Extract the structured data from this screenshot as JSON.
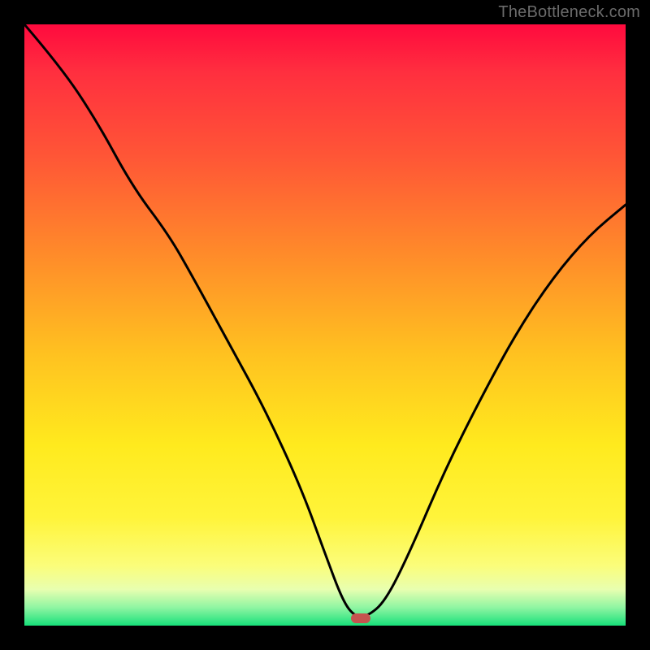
{
  "watermark": "TheBottleneck.com",
  "colors": {
    "background": "#000000",
    "curve": "#000000",
    "marker": "#c5534f",
    "watermark": "#6b6b6b",
    "gradient_top": "#ff0a3e",
    "gradient_bottom": "#17e07a"
  },
  "chart_data": {
    "type": "line",
    "title": "",
    "xlabel": "",
    "ylabel": "",
    "xlim": [
      0,
      100
    ],
    "ylim": [
      0,
      100
    ],
    "series": [
      {
        "name": "bottleneck-curve",
        "x": [
          0,
          6,
          12,
          18,
          24,
          28,
          34,
          40,
          46,
          50,
          53,
          55,
          57,
          60,
          64,
          70,
          76,
          82,
          88,
          94,
          100
        ],
        "values": [
          100,
          93,
          84,
          73,
          65,
          58,
          47,
          36,
          23,
          12,
          4,
          1.5,
          1.5,
          4,
          12,
          26,
          38,
          49,
          58,
          65,
          70
        ]
      }
    ],
    "marker": {
      "x": 56,
      "y": 1.2
    },
    "annotations": []
  }
}
